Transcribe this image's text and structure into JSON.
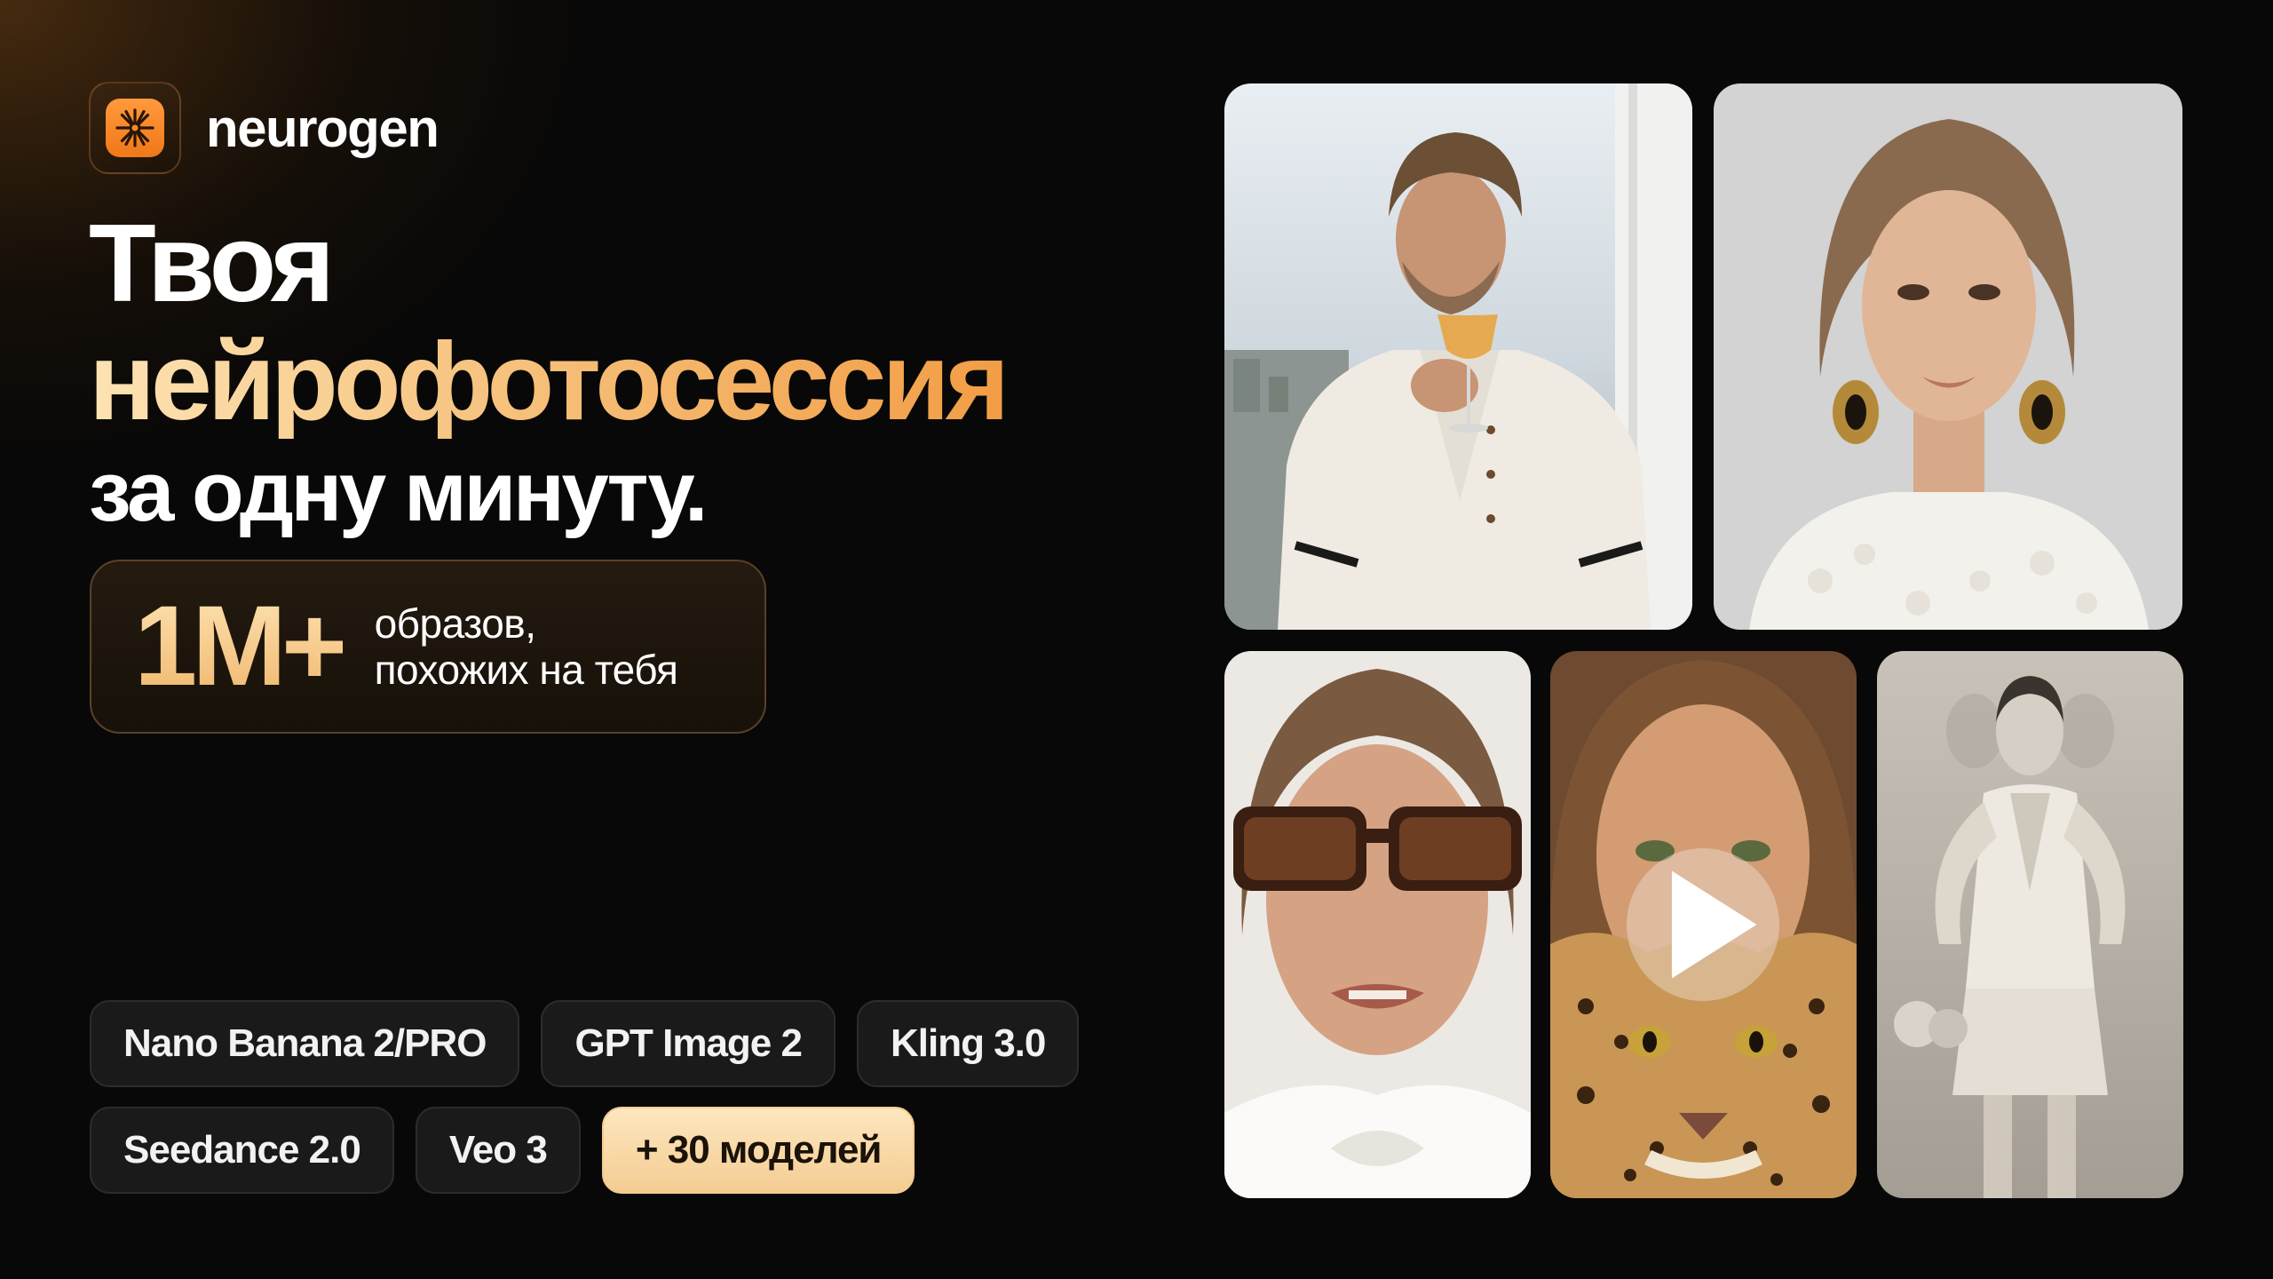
{
  "brand": {
    "name": "neurogen",
    "logo_icon": "asterisk-burst-icon",
    "accent_color": "#f58a2a"
  },
  "headline": {
    "line1": "Твоя",
    "line2": "нейрофотосессия",
    "line3": "за одну минуту."
  },
  "stat": {
    "value": "1M+",
    "caption_line1": "образов,",
    "caption_line2": "похожих на тебя"
  },
  "models": {
    "row1": [
      "Nano Banana 2/PRO",
      "GPT Image 2",
      "Kling 3.0"
    ],
    "row2": [
      "Seedance 2.0",
      "Veo 3"
    ],
    "more": "+ 30 моделей"
  },
  "gallery": {
    "play_icon": "play-icon"
  }
}
